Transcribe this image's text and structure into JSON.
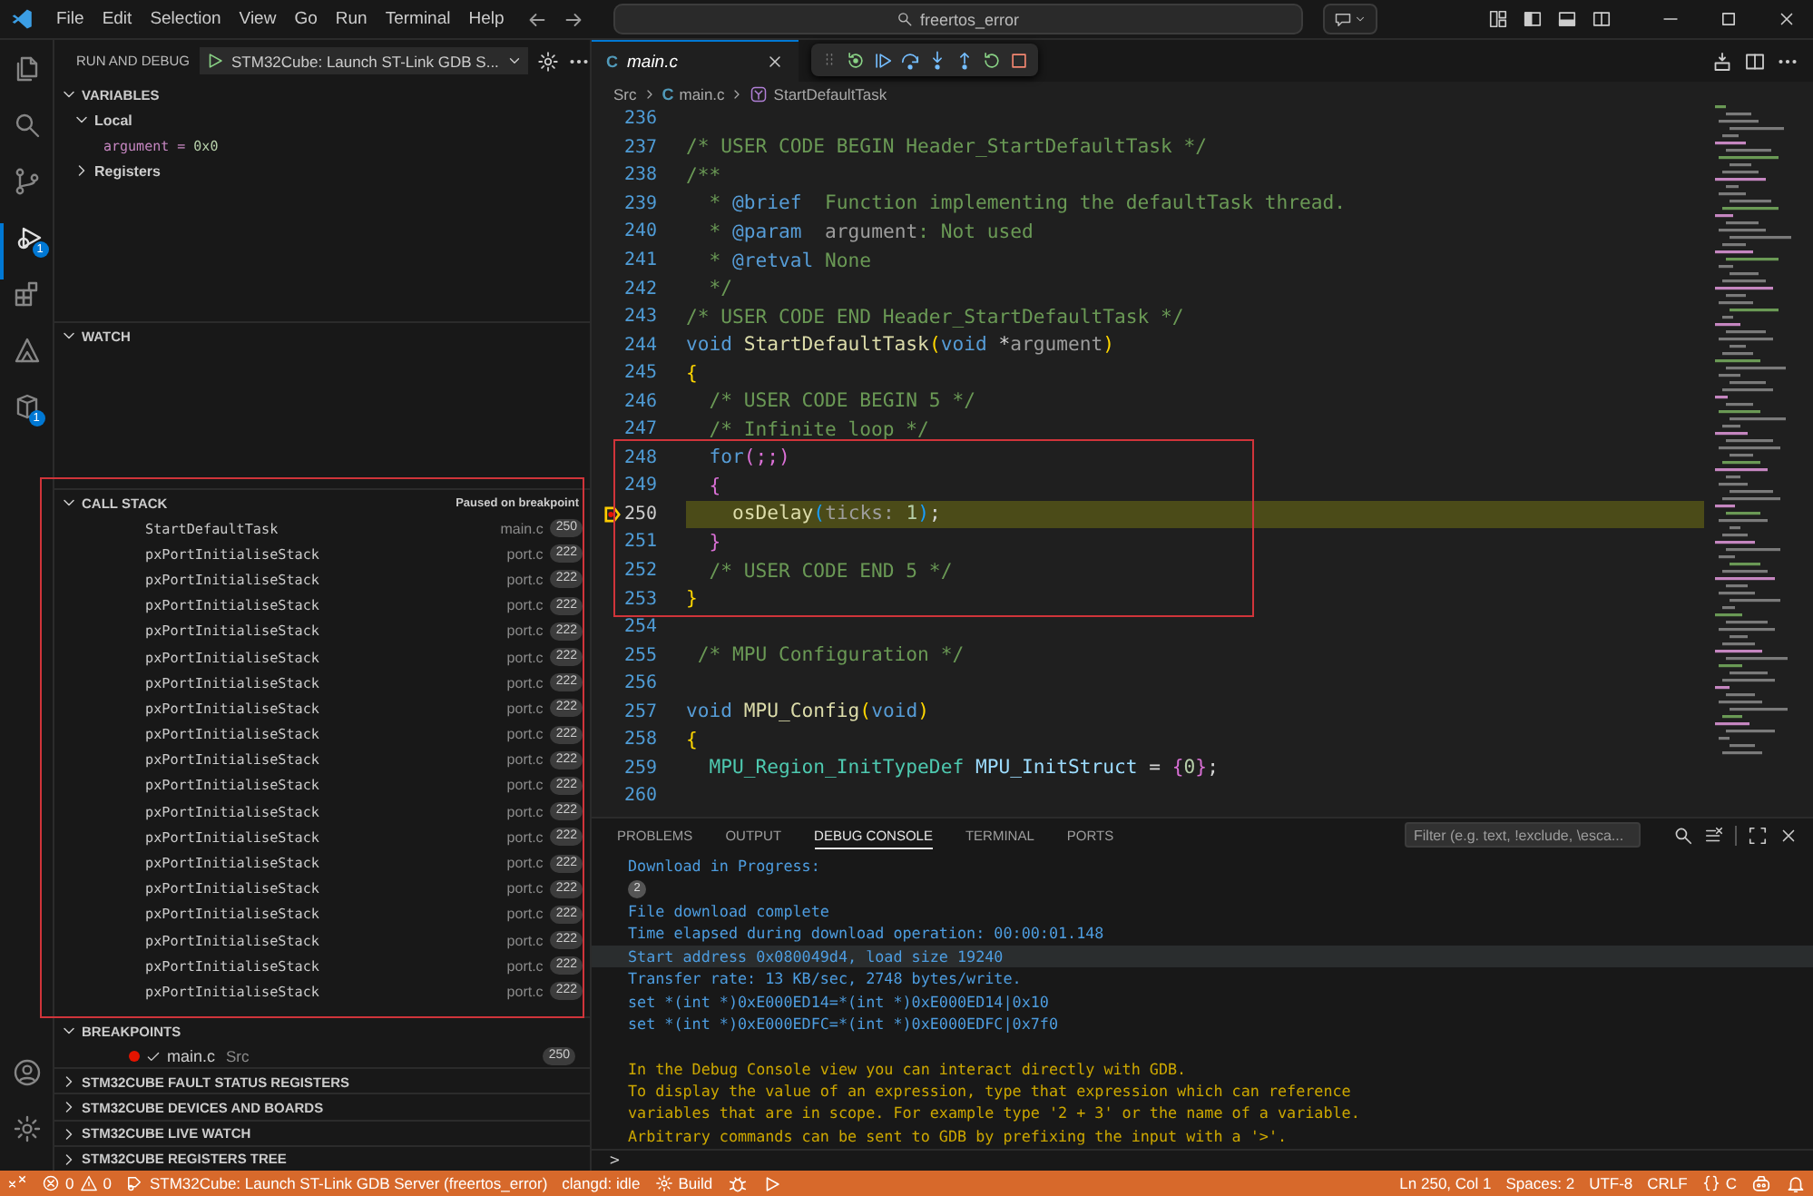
{
  "title_bar": {
    "menu": [
      "File",
      "Edit",
      "Selection",
      "View",
      "Go",
      "Run",
      "Terminal",
      "Help"
    ],
    "search": "freertos_error"
  },
  "activity_bar": {
    "items": [
      {
        "kind": "files",
        "selected": false
      },
      {
        "kind": "search",
        "selected": false
      },
      {
        "kind": "source-control",
        "selected": false
      },
      {
        "kind": "run-debug",
        "selected": true,
        "badge": "1"
      },
      {
        "kind": "extensions",
        "selected": false
      },
      {
        "kind": "triangle",
        "selected": false
      },
      {
        "kind": "cube",
        "selected": false,
        "badge": "1"
      }
    ],
    "bottom": [
      {
        "kind": "account"
      },
      {
        "kind": "settings"
      }
    ]
  },
  "sidebar": {
    "title": "RUN AND DEBUG",
    "launch_config": "STM32Cube: Launch ST-Link GDB S...",
    "variables": {
      "title": "VARIABLES",
      "expanded": true,
      "scopes": [
        {
          "label": "Local",
          "expanded": true,
          "children": [
            {
              "name": "argument",
              "operator": "=",
              "value": "0x0"
            }
          ]
        },
        {
          "label": "Registers",
          "expanded": false
        }
      ]
    },
    "watch": {
      "title": "WATCH",
      "expanded": true
    },
    "call_stack": {
      "title": "CALL STACK",
      "expanded": true,
      "status": "Paused on breakpoint",
      "annotated": true,
      "frames": [
        {
          "name": "StartDefaultTask",
          "file": "main.c",
          "line": "250"
        },
        {
          "name": "pxPortInitialiseStack",
          "file": "port.c",
          "line": "222"
        },
        {
          "name": "pxPortInitialiseStack",
          "file": "port.c",
          "line": "222"
        },
        {
          "name": "pxPortInitialiseStack",
          "file": "port.c",
          "line": "222"
        },
        {
          "name": "pxPortInitialiseStack",
          "file": "port.c",
          "line": "222"
        },
        {
          "name": "pxPortInitialiseStack",
          "file": "port.c",
          "line": "222"
        },
        {
          "name": "pxPortInitialiseStack",
          "file": "port.c",
          "line": "222"
        },
        {
          "name": "pxPortInitialiseStack",
          "file": "port.c",
          "line": "222"
        },
        {
          "name": "pxPortInitialiseStack",
          "file": "port.c",
          "line": "222"
        },
        {
          "name": "pxPortInitialiseStack",
          "file": "port.c",
          "line": "222"
        },
        {
          "name": "pxPortInitialiseStack",
          "file": "port.c",
          "line": "222"
        },
        {
          "name": "pxPortInitialiseStack",
          "file": "port.c",
          "line": "222"
        },
        {
          "name": "pxPortInitialiseStack",
          "file": "port.c",
          "line": "222"
        },
        {
          "name": "pxPortInitialiseStack",
          "file": "port.c",
          "line": "222"
        },
        {
          "name": "pxPortInitialiseStack",
          "file": "port.c",
          "line": "222"
        },
        {
          "name": "pxPortInitialiseStack",
          "file": "port.c",
          "line": "222"
        },
        {
          "name": "pxPortInitialiseStack",
          "file": "port.c",
          "line": "222"
        },
        {
          "name": "pxPortInitialiseStack",
          "file": "port.c",
          "line": "222"
        },
        {
          "name": "pxPortInitialiseStack",
          "file": "port.c",
          "line": "222"
        }
      ]
    },
    "breakpoints": {
      "title": "BREAKPOINTS",
      "expanded": true,
      "items": [
        {
          "file": "main.c",
          "folder": "Src",
          "line": "250",
          "checked": true
        }
      ]
    },
    "collapsed_sections": [
      {
        "title": "STM32CUBE FAULT STATUS REGISTERS",
        "expanded": false
      },
      {
        "title": "STM32CUBE DEVICES AND BOARDS",
        "expanded": false
      },
      {
        "title": "STM32CUBE LIVE WATCH",
        "expanded": false
      },
      {
        "title": "STM32CUBE REGISTERS TREE",
        "expanded": false
      }
    ]
  },
  "editor": {
    "tab": {
      "icon": "C",
      "label": "main.c",
      "selected": true
    },
    "breadcrumb": [
      {
        "kind": "folder",
        "text": "Src"
      },
      {
        "kind": "file",
        "icon": "C",
        "text": "main.c"
      },
      {
        "kind": "symbol",
        "text": "StartDefaultTask"
      }
    ],
    "lines": [
      {
        "number": "236"
      },
      {
        "number": "237",
        "tokens": [
          {
            "kind": "comment",
            "text": "/* USER CODE BEGIN Header_StartDefaultTask */"
          }
        ]
      },
      {
        "number": "238",
        "tokens": [
          {
            "kind": "comment",
            "text": "/**"
          }
        ]
      },
      {
        "number": "239",
        "tokens": [
          {
            "kind": "comment",
            "text": "  * "
          },
          {
            "kind": "doctag",
            "text": "@brief"
          },
          {
            "kind": "comment",
            "text": "  Function implementing the defaultTask thread."
          }
        ]
      },
      {
        "number": "240",
        "tokens": [
          {
            "kind": "comment",
            "text": "  * "
          },
          {
            "kind": "doctag",
            "text": "@param"
          },
          {
            "kind": "hint",
            "text": "  argument"
          },
          {
            "kind": "comment",
            "text": ": Not used"
          }
        ]
      },
      {
        "number": "241",
        "tokens": [
          {
            "kind": "comment",
            "text": "  * "
          },
          {
            "kind": "doctag",
            "text": "@retval"
          },
          {
            "kind": "comment",
            "text": " None"
          }
        ]
      },
      {
        "number": "242",
        "tokens": [
          {
            "kind": "comment",
            "text": "  */"
          }
        ]
      },
      {
        "number": "243",
        "tokens": [
          {
            "kind": "comment",
            "text": "/* USER CODE END Header_StartDefaultTask */"
          }
        ]
      },
      {
        "number": "244",
        "tokens": [
          {
            "kind": "keyword",
            "text": "void "
          },
          {
            "kind": "function",
            "text": "StartDefaultTask"
          },
          {
            "kind": "brace",
            "text": "("
          },
          {
            "kind": "keyword",
            "text": "void"
          },
          {
            "kind": "plain",
            "text": " *"
          },
          {
            "kind": "hint",
            "text": "argument"
          },
          {
            "kind": "brace",
            "text": ")"
          }
        ]
      },
      {
        "number": "245",
        "tokens": [
          {
            "kind": "brace",
            "text": "{"
          }
        ]
      },
      {
        "number": "246",
        "tokens": [
          {
            "kind": "comment",
            "text": "  /* USER CODE BEGIN 5 */"
          }
        ]
      },
      {
        "number": "247",
        "tokens": [
          {
            "kind": "comment",
            "text": "  /* Infinite loop */"
          }
        ]
      },
      {
        "kind": "annotation",
        "lines": [
          {
            "number": "248",
            "tokens": [
              {
                "kind": "keyword",
                "text": "  for"
              },
              {
                "kind": "brace2",
                "text": "(;;)"
              }
            ]
          },
          {
            "number": "249",
            "tokens": [
              {
                "kind": "brace2",
                "text": "  {"
              }
            ]
          },
          {
            "number": "250",
            "current": true,
            "breakpoint": true,
            "tokens": [
              {
                "kind": "function",
                "text": "    osDelay"
              },
              {
                "kind": "brace3",
                "text": "("
              },
              {
                "kind": "hint",
                "text": "ticks: "
              },
              {
                "kind": "number",
                "text": "1"
              },
              {
                "kind": "brace3",
                "text": ")"
              },
              {
                "kind": "plain",
                "text": ";"
              }
            ]
          },
          {
            "number": "251",
            "tokens": [
              {
                "kind": "brace2",
                "text": "  }"
              }
            ]
          },
          {
            "number": "252",
            "tokens": [
              {
                "kind": "comment",
                "text": "  /* USER CODE END 5 */"
              }
            ]
          },
          {
            "number": "253",
            "tokens": [
              {
                "kind": "brace",
                "text": "}"
              }
            ]
          }
        ]
      },
      {
        "number": "254"
      },
      {
        "number": "255",
        "tokens": [
          {
            "kind": "comment",
            "text": " /* MPU Configuration */"
          }
        ]
      },
      {
        "number": "256"
      },
      {
        "number": "257",
        "tokens": [
          {
            "kind": "keyword",
            "text": "void "
          },
          {
            "kind": "function",
            "text": "MPU_Config"
          },
          {
            "kind": "brace",
            "text": "("
          },
          {
            "kind": "keyword",
            "text": "void"
          },
          {
            "kind": "brace",
            "text": ")"
          }
        ]
      },
      {
        "number": "258",
        "tokens": [
          {
            "kind": "brace",
            "text": "{"
          }
        ]
      },
      {
        "number": "259",
        "tokens": [
          {
            "kind": "type",
            "text": "  MPU_Region_InitTypeDef "
          },
          {
            "kind": "variable",
            "text": "MPU_InitStruct"
          },
          {
            "kind": "plain",
            "text": " = "
          },
          {
            "kind": "brace2",
            "text": "{"
          },
          {
            "kind": "number",
            "text": "0"
          },
          {
            "kind": "brace2",
            "text": "}"
          },
          {
            "kind": "plain",
            "text": ";"
          }
        ]
      },
      {
        "number": "260"
      }
    ]
  },
  "panel": {
    "tabs": [
      {
        "label": "PROBLEMS",
        "selected": false
      },
      {
        "label": "OUTPUT",
        "selected": false
      },
      {
        "label": "DEBUG CONSOLE",
        "selected": true
      },
      {
        "label": "TERMINAL",
        "selected": false
      },
      {
        "label": "PORTS",
        "selected": false
      }
    ],
    "filter_placeholder": "Filter (e.g. text, !exclude, \\esca...",
    "console": [
      {
        "kind": "output",
        "text": "Download in Progress:"
      },
      {
        "kind": "count",
        "text": "2"
      },
      {
        "kind": "output",
        "text": "File download complete"
      },
      {
        "kind": "output",
        "text": "Time elapsed during download operation: 00:00:01.148"
      },
      {
        "kind": "output",
        "text": "Start address 0x080049d4, load size 19240",
        "highlighted": true
      },
      {
        "kind": "output",
        "text": "Transfer rate: 13 KB/sec, 2748 bytes/write."
      },
      {
        "kind": "output",
        "text": "set *(int *)0xE000ED14=*(int *)0xE000ED14|0x10"
      },
      {
        "kind": "output",
        "text": "set *(int *)0xE000EDFC=*(int *)0xE000EDFC|0x7f0"
      },
      {
        "kind": "blank"
      },
      {
        "kind": "notice",
        "text": "In the Debug Console view you can interact directly with GDB."
      },
      {
        "kind": "notice",
        "text": "To display the value of an expression, type that expression which can reference"
      },
      {
        "kind": "notice",
        "text": "variables that are in scope. For example type '2 + 3' or the name of a variable."
      },
      {
        "kind": "notice",
        "text": "Arbitrary commands can be sent to GDB by prefixing the input with a '>'."
      }
    ],
    "prompt": ">"
  },
  "status_bar": {
    "left": [
      {
        "kind": "remote"
      },
      {
        "kind": "problems",
        "errors": "0",
        "warnings": "0"
      },
      {
        "kind": "launch",
        "text": "STM32Cube: Launch ST-Link GDB Server (freertos_error)"
      },
      {
        "kind": "text",
        "text": "clangd: idle"
      },
      {
        "kind": "build",
        "text": "Build"
      },
      {
        "kind": "bug"
      },
      {
        "kind": "play"
      }
    ],
    "right": [
      {
        "kind": "text",
        "text": "Ln 250, Col 1"
      },
      {
        "kind": "text",
        "text": "Spaces: 2"
      },
      {
        "kind": "text",
        "text": "UTF-8"
      },
      {
        "kind": "text",
        "text": "CRLF"
      },
      {
        "kind": "language",
        "text": "C"
      },
      {
        "kind": "copilot"
      },
      {
        "kind": "bell"
      }
    ]
  }
}
